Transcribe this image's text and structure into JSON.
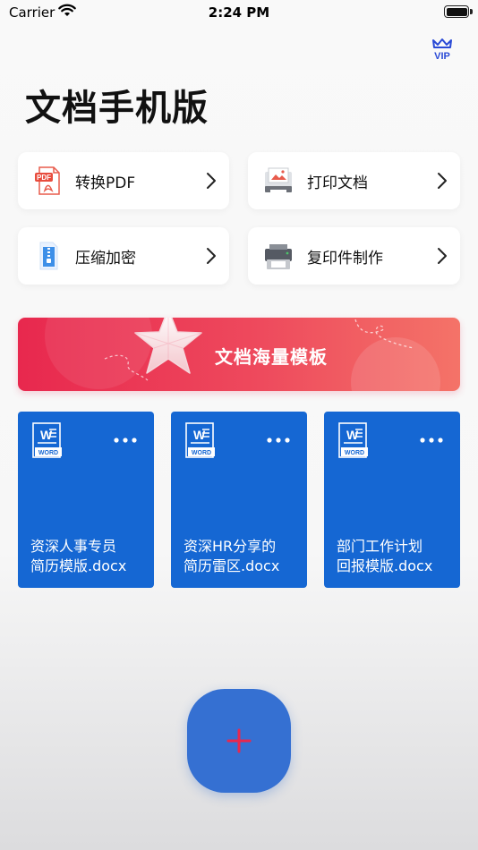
{
  "status_bar": {
    "carrier": "Carrier",
    "time": "2:24 PM"
  },
  "header": {
    "title": "文档手机版",
    "vip_badge": "VIP"
  },
  "tools": [
    {
      "label": "转换PDF",
      "icon": "pdf-icon"
    },
    {
      "label": "打印文档",
      "icon": "image-print-icon"
    },
    {
      "label": "压缩加密",
      "icon": "zip-file-icon"
    },
    {
      "label": "复印件制作",
      "icon": "printer-icon"
    }
  ],
  "banner": {
    "title": "文档海量模板",
    "icon": "star-icon"
  },
  "documents": [
    {
      "line1": "资深人事专员",
      "line2": "简历模版.docx",
      "badge": "WORD"
    },
    {
      "line1": "资深HR分享的",
      "line2": "简历雷区.docx",
      "badge": "WORD"
    },
    {
      "line1": "部门工作计划",
      "line2": "回报模版.docx",
      "badge": "WORD"
    }
  ],
  "fab": {
    "icon": "plus-icon",
    "color": "#3570d2",
    "plus_color": "#e8284e"
  },
  "colors": {
    "doc_card": "#1567d3",
    "banner": "#e8284e",
    "vip": "#2a4ad6"
  }
}
